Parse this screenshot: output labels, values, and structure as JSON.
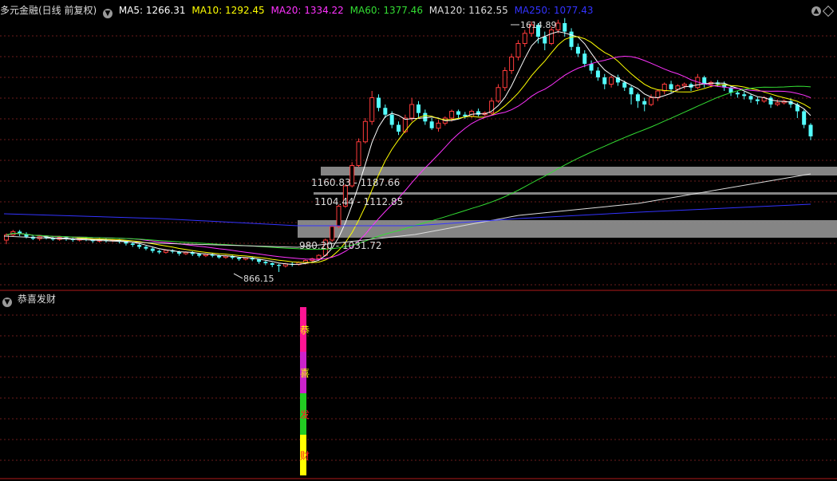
{
  "header": {
    "title": "多元金融(日线 前复权)",
    "indicators": [
      {
        "label": "MA5: 1266.31",
        "color": "#ffffff"
      },
      {
        "label": "MA10: 1292.45",
        "color": "#ffff00"
      },
      {
        "label": "MA20: 1334.22",
        "color": "#ff33ff"
      },
      {
        "label": "MA60: 1377.46",
        "color": "#33dd33"
      },
      {
        "label": "MA120: 1162.55",
        "color": "#dddddd"
      },
      {
        "label": "MA250: 1077.43",
        "color": "#3333ff"
      }
    ]
  },
  "colors": {
    "up": "#ff3b3b",
    "down": "#54ffff",
    "grid": "#6b1b1b",
    "zone": "#8c8c8c",
    "ma5": "#ffffff",
    "ma10": "#ffff00",
    "ma20": "#ff33ff",
    "ma60": "#33dd33",
    "ma120": "#dddddd",
    "ma250": "#3333ff"
  },
  "sub_panel": {
    "title": "恭喜发财",
    "chars": [
      "恭",
      "喜",
      "发",
      "财"
    ],
    "bar_colors": [
      "#ff1493",
      "#cc22cc",
      "#22cc22",
      "#ffff00"
    ],
    "char_colors": [
      "#ffff00",
      "#ffff00",
      "#ff2222",
      "#ff2222"
    ]
  },
  "chart_data": {
    "type": "candlestick",
    "title": "多元金融(日线 前复权)",
    "ylim": [
      840,
      1640
    ],
    "high_annotation": "1614.89",
    "low_annotation": "866.15",
    "zones": [
      {
        "label": "1160.83 - 1187.66",
        "low": 1160.83,
        "high": 1187.66
      },
      {
        "label": "1104.44 - 1112.85",
        "low": 1104.44,
        "high": 1112.85
      },
      {
        "label": "980.20 - 1031.72",
        "low": 980.2,
        "high": 1031.72
      }
    ],
    "candles": [
      [
        960,
        975,
        948,
        980
      ],
      [
        975,
        985,
        970,
        990
      ],
      [
        985,
        978,
        972,
        990
      ],
      [
        978,
        970,
        965,
        983
      ],
      [
        970,
        964,
        960,
        975
      ],
      [
        964,
        970,
        958,
        974
      ],
      [
        970,
        966,
        962,
        974
      ],
      [
        966,
        962,
        958,
        970
      ],
      [
        962,
        968,
        958,
        972
      ],
      [
        968,
        963,
        958,
        971
      ],
      [
        963,
        960,
        955,
        967
      ],
      [
        960,
        966,
        956,
        970
      ],
      [
        966,
        962,
        957,
        969
      ],
      [
        962,
        957,
        952,
        965
      ],
      [
        957,
        962,
        953,
        966
      ],
      [
        962,
        958,
        953,
        965
      ],
      [
        958,
        960,
        954,
        963
      ],
      [
        960,
        955,
        950,
        963
      ],
      [
        955,
        950,
        944,
        958
      ],
      [
        950,
        946,
        940,
        953
      ],
      [
        946,
        940,
        934,
        949
      ],
      [
        940,
        935,
        930,
        943
      ],
      [
        935,
        928,
        922,
        938
      ],
      [
        928,
        924,
        919,
        932
      ],
      [
        924,
        930,
        920,
        933
      ],
      [
        930,
        926,
        921,
        933
      ],
      [
        926,
        920,
        914,
        929
      ],
      [
        920,
        924,
        916,
        927
      ],
      [
        924,
        919,
        913,
        927
      ],
      [
        919,
        914,
        909,
        922
      ],
      [
        914,
        918,
        910,
        921
      ],
      [
        918,
        914,
        909,
        921
      ],
      [
        914,
        909,
        905,
        917
      ],
      [
        909,
        913,
        905,
        916
      ],
      [
        913,
        908,
        903,
        915
      ],
      [
        908,
        904,
        899,
        911
      ],
      [
        904,
        908,
        900,
        910
      ],
      [
        908,
        903,
        898,
        911
      ],
      [
        903,
        896,
        890,
        905
      ],
      [
        896,
        892,
        886,
        899
      ],
      [
        892,
        887,
        880,
        894
      ],
      [
        887,
        884,
        866,
        890
      ],
      [
        884,
        890,
        879,
        893
      ],
      [
        890,
        888,
        882,
        895
      ],
      [
        888,
        894,
        885,
        897
      ],
      [
        894,
        900,
        888,
        903
      ],
      [
        900,
        905,
        894,
        908
      ],
      [
        905,
        915,
        900,
        918
      ],
      [
        915,
        960,
        912,
        965
      ],
      [
        960,
        1000,
        955,
        1005
      ],
      [
        1000,
        1060,
        995,
        1065
      ],
      [
        1060,
        1120,
        1055,
        1125
      ],
      [
        1120,
        1180,
        1115,
        1190
      ],
      [
        1180,
        1250,
        1175,
        1260
      ],
      [
        1250,
        1310,
        1245,
        1320
      ],
      [
        1310,
        1380,
        1300,
        1400
      ],
      [
        1380,
        1350,
        1340,
        1390
      ],
      [
        1350,
        1330,
        1320,
        1360
      ],
      [
        1330,
        1300,
        1290,
        1340
      ],
      [
        1300,
        1280,
        1270,
        1310
      ],
      [
        1280,
        1320,
        1275,
        1330
      ],
      [
        1320,
        1360,
        1310,
        1380
      ],
      [
        1360,
        1335,
        1320,
        1370
      ],
      [
        1335,
        1310,
        1300,
        1345
      ],
      [
        1310,
        1290,
        1285,
        1320
      ],
      [
        1290,
        1305,
        1280,
        1315
      ],
      [
        1305,
        1320,
        1298,
        1325
      ],
      [
        1320,
        1340,
        1310,
        1345
      ],
      [
        1340,
        1330,
        1320,
        1345
      ],
      [
        1330,
        1325,
        1318,
        1338
      ],
      [
        1325,
        1340,
        1320,
        1345
      ],
      [
        1340,
        1330,
        1325,
        1348
      ],
      [
        1330,
        1335,
        1325,
        1340
      ],
      [
        1335,
        1370,
        1330,
        1380
      ],
      [
        1370,
        1410,
        1365,
        1420
      ],
      [
        1410,
        1460,
        1400,
        1470
      ],
      [
        1460,
        1500,
        1450,
        1510
      ],
      [
        1500,
        1540,
        1490,
        1550
      ],
      [
        1540,
        1570,
        1530,
        1580
      ],
      [
        1570,
        1595,
        1560,
        1605
      ],
      [
        1595,
        1560,
        1540,
        1600
      ],
      [
        1560,
        1540,
        1520,
        1575
      ],
      [
        1540,
        1580,
        1535,
        1590
      ],
      [
        1580,
        1600,
        1570,
        1610
      ],
      [
        1600,
        1575,
        1560,
        1614.89
      ],
      [
        1575,
        1530,
        1520,
        1585
      ],
      [
        1530,
        1510,
        1500,
        1540
      ],
      [
        1510,
        1480,
        1470,
        1520
      ],
      [
        1480,
        1460,
        1450,
        1490
      ],
      [
        1460,
        1440,
        1430,
        1470
      ],
      [
        1440,
        1420,
        1405,
        1450
      ],
      [
        1420,
        1440,
        1410,
        1445
      ],
      [
        1440,
        1425,
        1415,
        1448
      ],
      [
        1425,
        1410,
        1400,
        1430
      ],
      [
        1410,
        1390,
        1360,
        1415
      ],
      [
        1390,
        1370,
        1350,
        1395
      ],
      [
        1370,
        1360,
        1340,
        1380
      ],
      [
        1360,
        1380,
        1355,
        1390
      ],
      [
        1380,
        1400,
        1370,
        1405
      ],
      [
        1400,
        1420,
        1390,
        1425
      ],
      [
        1420,
        1405,
        1395,
        1430
      ],
      [
        1405,
        1415,
        1400,
        1420
      ],
      [
        1415,
        1420,
        1405,
        1425
      ],
      [
        1420,
        1410,
        1400,
        1425
      ],
      [
        1410,
        1440,
        1405,
        1450
      ],
      [
        1440,
        1420,
        1410,
        1445
      ],
      [
        1420,
        1425,
        1410,
        1430
      ],
      [
        1425,
        1420,
        1412,
        1432
      ],
      [
        1420,
        1410,
        1400,
        1428
      ],
      [
        1410,
        1395,
        1385,
        1415
      ],
      [
        1395,
        1390,
        1380,
        1400
      ],
      [
        1390,
        1385,
        1375,
        1398
      ],
      [
        1385,
        1375,
        1365,
        1392
      ],
      [
        1375,
        1370,
        1360,
        1382
      ],
      [
        1370,
        1380,
        1365,
        1385
      ],
      [
        1380,
        1360,
        1350,
        1385
      ],
      [
        1360,
        1365,
        1355,
        1375
      ],
      [
        1365,
        1370,
        1360,
        1375
      ],
      [
        1370,
        1360,
        1350,
        1378
      ],
      [
        1360,
        1340,
        1320,
        1365
      ],
      [
        1340,
        1300,
        1290,
        1345
      ],
      [
        1300,
        1266,
        1255,
        1305
      ]
    ]
  }
}
